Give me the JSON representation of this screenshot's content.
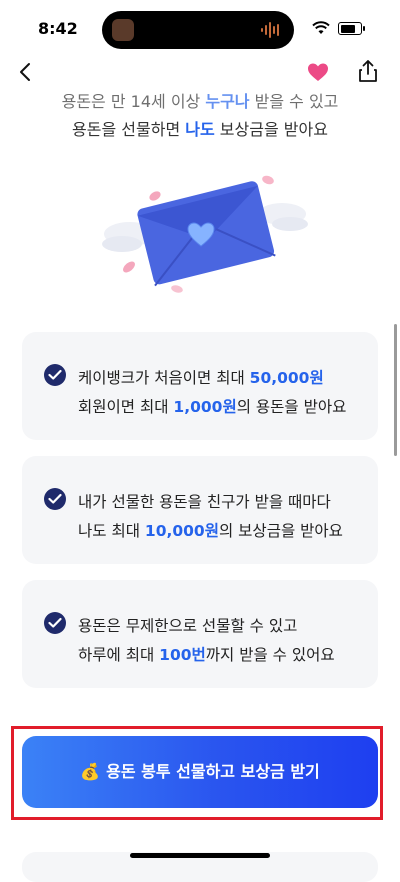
{
  "status_bar": {
    "time": "8:42"
  },
  "intro": {
    "line1_pre": "용돈은 만 14세 이상 ",
    "line1_hl": "누구나",
    "line1_post": " 받을 수 있고",
    "line2_pre": "용돈을 선물하면 ",
    "line2_hl": "나도",
    "line2_post": " 보상금을 받아요"
  },
  "cards": [
    {
      "line1_pre": "케이뱅크가 처음이면 최대 ",
      "line1_hl": "50,000원",
      "line1_post": "",
      "line2_pre": "회원이면 최대 ",
      "line2_hl": "1,000원",
      "line2_post": "의 용돈을 받아요"
    },
    {
      "line1_pre": "내가 선물한 용돈을 친구가 받을 때마다",
      "line1_hl": "",
      "line1_post": "",
      "line2_pre": "나도 최대 ",
      "line2_hl": "10,000원",
      "line2_post": "의 보상금을 받아요"
    },
    {
      "line1_pre": "용돈은 무제한으로 선물할 수 있고",
      "line1_hl": "",
      "line1_post": "",
      "line2_pre": "하루에 최대 ",
      "line2_hl": "100번",
      "line2_post": "까지 받을 수 있어요"
    }
  ],
  "cta": {
    "emoji": "💰",
    "label": "용돈 봉투 선물하고 보상금 받기"
  },
  "colors": {
    "accent": "#2563eb",
    "heart": "#ec4a86",
    "cta_start": "#3b82f6",
    "cta_end": "#1e3ff0",
    "highlight_box": "#e11d2a"
  }
}
